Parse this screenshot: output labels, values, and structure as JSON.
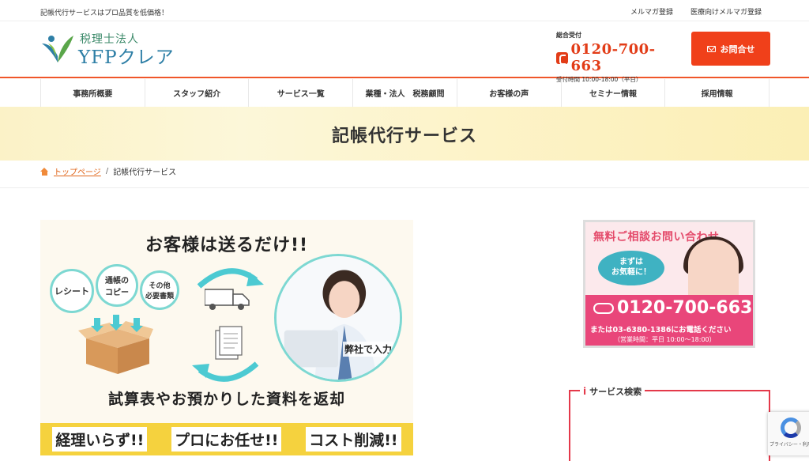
{
  "topbar": {
    "tagline": "記帳代行サービスはプロ品質を低価格！",
    "links": [
      "メルマガ登録",
      "医療向けメルマガ登録"
    ]
  },
  "header": {
    "logo_sub": "税理士法人",
    "logo_main": "YFPクレア",
    "tel_label": "総合受付",
    "tel_number": "0120-700-663",
    "tel_hours": "受付時間 10:00-18:00（平日）",
    "contact_label": "お問合せ"
  },
  "nav": {
    "items": [
      "事務所概要",
      "スタッフ紹介",
      "サービス一覧",
      "業種・法人　税務顧問",
      "お客様の声",
      "セミナー情報",
      "採用情報"
    ]
  },
  "hero": {
    "title": "記帳代行サービス"
  },
  "breadcrumb": {
    "home": "トップページ",
    "separator": "/",
    "current": "記帳代行サービス"
  },
  "main_image": {
    "title": "お客様は送るだけ!!",
    "bubbles": [
      "レシート",
      "通帳の\nコピー",
      "その他\n必要書類"
    ],
    "person_caption": "弊社で入力",
    "subtitle": "試算表やお預かりした資料を返却",
    "band": [
      "経理いらず!!",
      "プロにお任せ!!",
      "コスト削減!!"
    ]
  },
  "side_banner": {
    "title": "無料ご相談お問い合わせ",
    "bubble": "まずは\nお気軽に！",
    "tel": "0120-700-663",
    "note": "または03-6380-1386にお電話ください",
    "hours": "（営業時間：平日 10:00〜18:00）"
  },
  "search": {
    "title": "サービス検索"
  },
  "recaptcha": {
    "text": "プライバシー・利用規約"
  },
  "colors": {
    "accent": "#f0401a",
    "nav_border": "#f0562a",
    "teal": "#4ccad2",
    "pink": "#e9467a",
    "yellow": "#f5d23e"
  }
}
